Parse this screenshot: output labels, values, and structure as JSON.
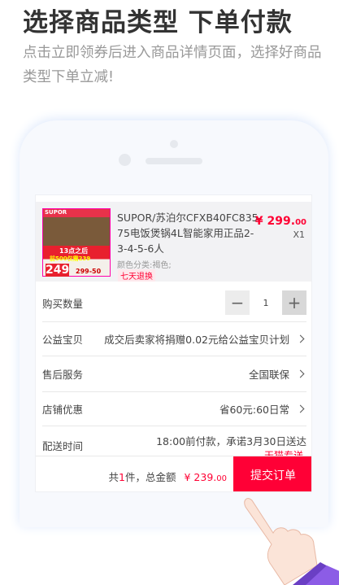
{
  "headline": "选择商品类型 下单付款",
  "subtitle": "点击立即领券后进入商品详情页面，选择好商品类型下单立减!",
  "product": {
    "title": "SUPOR/苏泊尔CFXB40FC835-75电饭煲锅4L智能家用正品2-3-4-5-6人",
    "meta": "颜色分类:褐色;",
    "tag": "七天退换",
    "price": "¥ 299.",
    "price_cents": "00",
    "qty": "X1",
    "image_texts": {
      "brand": "SUPOR",
      "promo1": "13点之后",
      "promo2": "前500仅需239",
      "price": "249",
      "coupon": "299-50"
    }
  },
  "rows": [
    {
      "label": "购买数量",
      "value": "1",
      "minus": "−",
      "plus": "+"
    },
    {
      "label": "公益宝贝",
      "value": "成交后卖家将捐赠0.02元给公益宝贝计划"
    },
    {
      "label": "售后服务",
      "value": "全国联保"
    },
    {
      "label": "店铺优惠",
      "value": "省60元:60日常"
    },
    {
      "label": "配送时间",
      "value": "18:00前付款，承诺3月30日送达",
      "extra": "天猫专送"
    }
  ],
  "bottom": {
    "count_prefix": "共",
    "count": "1",
    "count_suffix": "件，总金额",
    "total": "¥ 239.",
    "total_cents": "00",
    "submit": "提交订单"
  }
}
